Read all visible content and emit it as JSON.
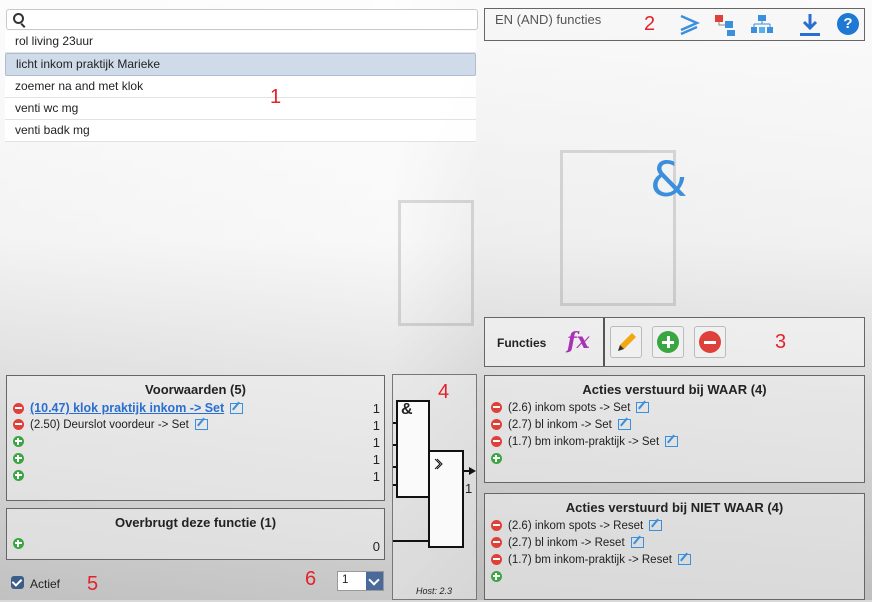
{
  "callouts": [
    "1",
    "2",
    "3",
    "4",
    "5",
    "6"
  ],
  "search": {
    "placeholder": ""
  },
  "list": {
    "items": [
      "rol living 23uur",
      "licht inkom praktijk Marieke",
      "zoemer na and met klok",
      "venti wc mg",
      "venti badk mg"
    ],
    "selected_index": 1
  },
  "function_type": {
    "title": "EN (AND) functies",
    "symbol": "&"
  },
  "toolbar_icons": [
    "greater-equal-icon",
    "flow-icon",
    "hierarchy-icon",
    "download-icon",
    "help-icon"
  ],
  "functies": {
    "label": "Functies",
    "fx_symbol": "fx"
  },
  "voorwaarden": {
    "title": "Voorwaarden (5)",
    "rows": [
      {
        "text": "(10.47) klok praktijk inkom -> Set",
        "count": "1"
      },
      {
        "text": "(2.50) Deurslot voordeur -> Set",
        "count": "1"
      },
      {
        "text": "",
        "count": "1"
      },
      {
        "text": "",
        "count": "1"
      },
      {
        "text": "",
        "count": "1"
      }
    ]
  },
  "overbrugt": {
    "title": "Overbrugt deze functie (1)",
    "count": "0"
  },
  "diagram": {
    "gate_symbol": "&",
    "output": "1",
    "host": "Host: 2.3"
  },
  "acties_waar": {
    "title": "Acties verstuurd bij WAAR (4)",
    "rows": [
      "(2.6) inkom spots -> Set",
      "(2.7) bl inkom -> Set",
      "(1.7) bm inkom-praktijk -> Set"
    ]
  },
  "acties_niet_waar": {
    "title": "Acties verstuurd bij NIET WAAR (4)",
    "rows": [
      "(2.6) inkom spots -> Reset",
      "(2.7) bl inkom -> Reset",
      "(1.7) bm inkom-praktijk -> Reset"
    ]
  },
  "footer": {
    "active_label": "Actief",
    "active_checked": true,
    "select_value": "1"
  },
  "colors": {
    "accent": "#3c8fdc",
    "callout": "#e3232a",
    "fx": "#a832b5",
    "remove": "#e0403a",
    "add": "#3aa642"
  }
}
